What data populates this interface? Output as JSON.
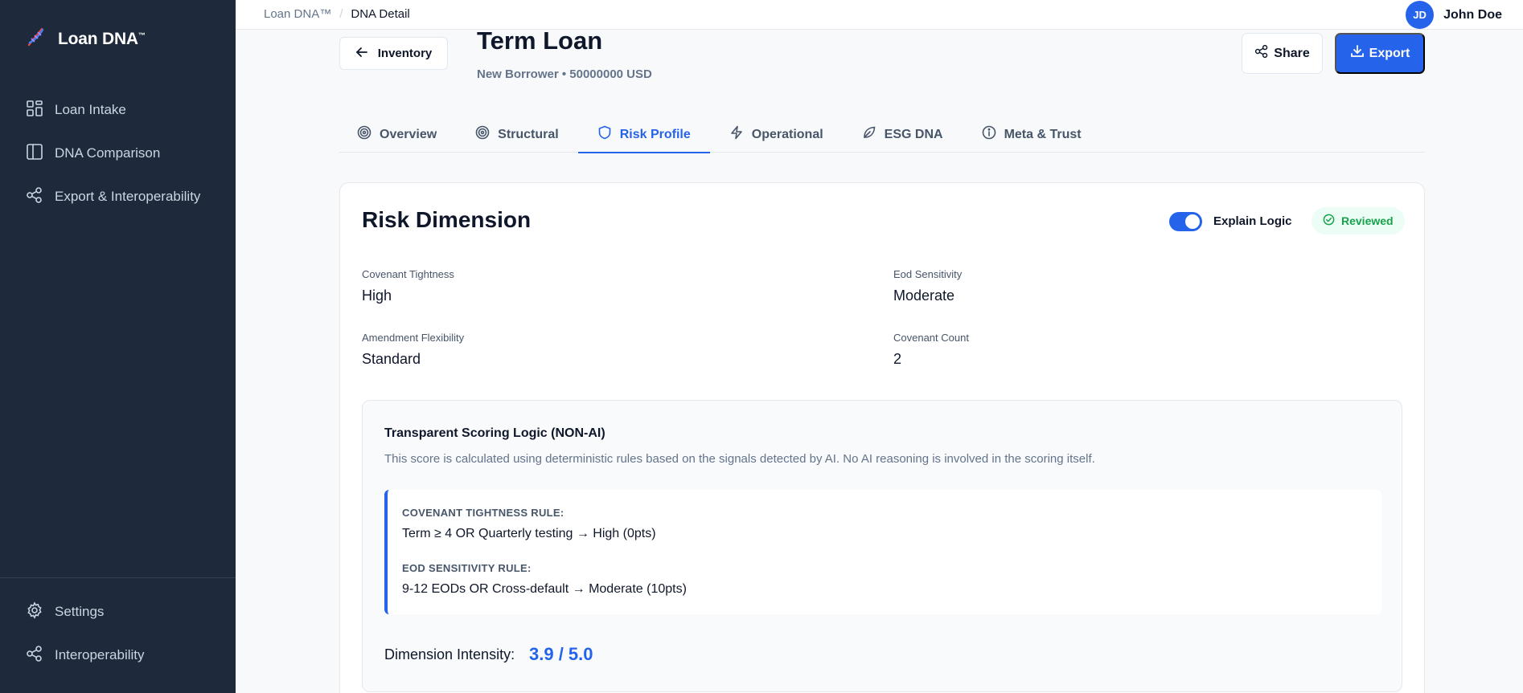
{
  "brand": {
    "name": "Loan DNA",
    "tm": "™"
  },
  "sidebar": {
    "items": [
      {
        "label": "Loan Intake",
        "icon": "grid-icon"
      },
      {
        "label": "DNA Comparison",
        "icon": "columns-icon"
      },
      {
        "label": "Export & Interoperability",
        "icon": "share-nodes-icon"
      }
    ],
    "bottom_items": [
      {
        "label": "Settings",
        "icon": "gear-icon"
      },
      {
        "label": "Interoperability",
        "icon": "share-nodes-icon"
      }
    ]
  },
  "topbar": {
    "breadcrumb": [
      "Loan DNA™",
      "DNA Detail"
    ],
    "user": {
      "initials": "JD",
      "name": "John Doe"
    }
  },
  "header": {
    "back_label": "Inventory",
    "title": "Term Loan",
    "subtitle": "New Borrower • 50000000 USD",
    "share_label": "Share",
    "export_label": "Export"
  },
  "tabs": [
    {
      "label": "Overview",
      "icon": "target-icon",
      "active": false
    },
    {
      "label": "Structural",
      "icon": "target-icon",
      "active": false
    },
    {
      "label": "Risk Profile",
      "icon": "shield-icon",
      "active": true
    },
    {
      "label": "Operational",
      "icon": "bolt-icon",
      "active": false
    },
    {
      "label": "ESG DNA",
      "icon": "leaf-icon",
      "active": false
    },
    {
      "label": "Meta & Trust",
      "icon": "info-icon",
      "active": false
    }
  ],
  "card": {
    "title": "Risk Dimension",
    "toggle_label": "Explain Logic",
    "toggle_on": true,
    "badge": "Reviewed",
    "fields": [
      {
        "label": "Covenant Tightness",
        "value": "High"
      },
      {
        "label": "Eod Sensitivity",
        "value": "Moderate"
      },
      {
        "label": "Amendment Flexibility",
        "value": "Standard"
      },
      {
        "label": "Covenant Count",
        "value": "2"
      }
    ],
    "logic": {
      "title": "Transparent Scoring Logic (NON-AI)",
      "description": "This score is calculated using deterministic rules based on the signals detected by AI. No AI reasoning is involved in the scoring itself.",
      "rules": [
        {
          "heading": "COVENANT TIGHTNESS RULE:",
          "text": "Term ≥ 4 OR Quarterly testing → High (0pts)"
        },
        {
          "heading": "EOD SENSITIVITY RULE:",
          "text": "9-12 EODs OR Cross-default → Moderate (10pts)"
        }
      ],
      "intensity_label": "Dimension Intensity:",
      "intensity_value": "3.9 / 5.0"
    }
  },
  "colors": {
    "accent": "#2563eb",
    "sidebar": "#1e293b",
    "success": "#16a34a"
  }
}
